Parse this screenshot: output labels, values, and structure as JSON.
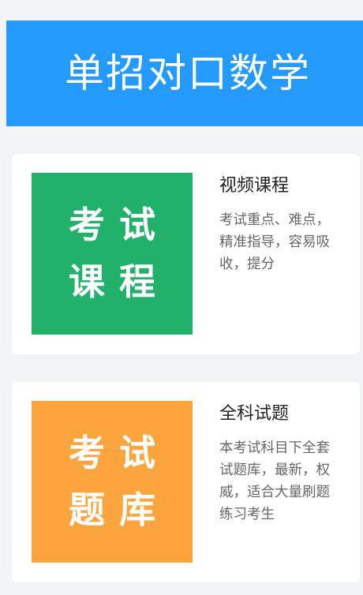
{
  "header": {
    "title": "单招对口数学",
    "background_color": "#239afc"
  },
  "cards": [
    {
      "thumb_line1": "考试",
      "thumb_line2": "课程",
      "thumb_color": "#21b16b",
      "title": "视频课程",
      "description": "考试重点、难点，精准指导，容易吸收，提分"
    },
    {
      "thumb_line1": "考试",
      "thumb_line2": "题库",
      "thumb_color": "#fca43e",
      "title": "全科试题",
      "description": "本考试科目下全套试题库，最新，权威，适合大量刷题练习考生"
    }
  ]
}
